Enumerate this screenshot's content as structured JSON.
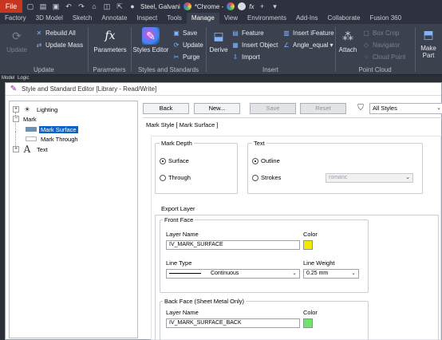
{
  "qat": {
    "file_label": "File",
    "material_label": "Steel, Galvani",
    "appearance_label": "*Chrome -",
    "fx_label": "fx"
  },
  "tabs": [
    "Factory",
    "3D Model",
    "Sketch",
    "Annotate",
    "Inspect",
    "Tools",
    "Manage",
    "View",
    "Environments",
    "Add-Ins",
    "Collaborate",
    "Fusion 360"
  ],
  "active_tab": "Manage",
  "ribbon": {
    "update": {
      "title": "Update",
      "big_label": "Update",
      "rebuild_all": "Rebuild All",
      "update_mass": "Update Mass"
    },
    "parameters": {
      "title": "Parameters",
      "big_label": "Parameters"
    },
    "styles": {
      "title": "Styles and Standards",
      "big_label": "Styles Editor",
      "save": "Save",
      "update": "Update",
      "purge": "Purge"
    },
    "insert": {
      "title": "Insert",
      "derive": "Derive",
      "feature": "Feature",
      "insert_object": "Insert Object",
      "import": "Import",
      "insert_ifeature": "Insert iFeature",
      "angle_equal": "Angle_equal"
    },
    "point_cloud": {
      "title": "Point Cloud",
      "attach": "Attach",
      "box_crop": "Box Crop",
      "navigator": "Navigator",
      "cloud_point": "Cloud Point"
    },
    "make": {
      "label1": "Make",
      "label2": "Part"
    }
  },
  "browser_tabs": {
    "model": "Model",
    "logic": "Logic"
  },
  "dialog": {
    "title": "Style and Standard Editor [Library - Read/Write]",
    "tree": [
      {
        "label": "Lighting",
        "toggle": "+"
      },
      {
        "label": "Mark",
        "toggle": "−"
      },
      {
        "label": "Mark Surface",
        "selected": true
      },
      {
        "label": "Mark Through"
      },
      {
        "label": "Text",
        "toggle": "+"
      }
    ],
    "toolbar": {
      "back": "Back",
      "new": "New...",
      "save": "Save",
      "reset": "Reset",
      "filter": "All Styles"
    },
    "mark_style_title": "Mark Style [ Mark Surface ]",
    "mark_depth": {
      "label": "Mark Depth",
      "options": [
        "Surface",
        "Through"
      ],
      "selected": "Surface"
    },
    "text": {
      "label": "Text",
      "options": [
        "Outline",
        "Strokes"
      ],
      "selected": "Outline",
      "font_value": "romanc"
    },
    "export_layer": {
      "label": "Export Layer",
      "front_face": {
        "label": "Front Face",
        "layer_name_label": "Layer Name",
        "layer_name_value": "IV_MARK_SURFACE",
        "color_label": "Color",
        "color": "#f5e800",
        "line_type_label": "Line Type",
        "line_type_value": "Continuous",
        "line_weight_label": "Line Weight",
        "line_weight_value": "0.25 mm"
      },
      "back_face": {
        "label": "Back Face (Sheet Metal Only)",
        "layer_name_label": "Layer Name",
        "layer_name_value": "IV_MARK_SURFACE_BACK",
        "color_label": "Color",
        "color": "#6fe46a"
      }
    }
  },
  "colors": {
    "accent": "#0a63c7",
    "file_tab": "#c9361f",
    "ribbon_bg": "#3c4150"
  }
}
